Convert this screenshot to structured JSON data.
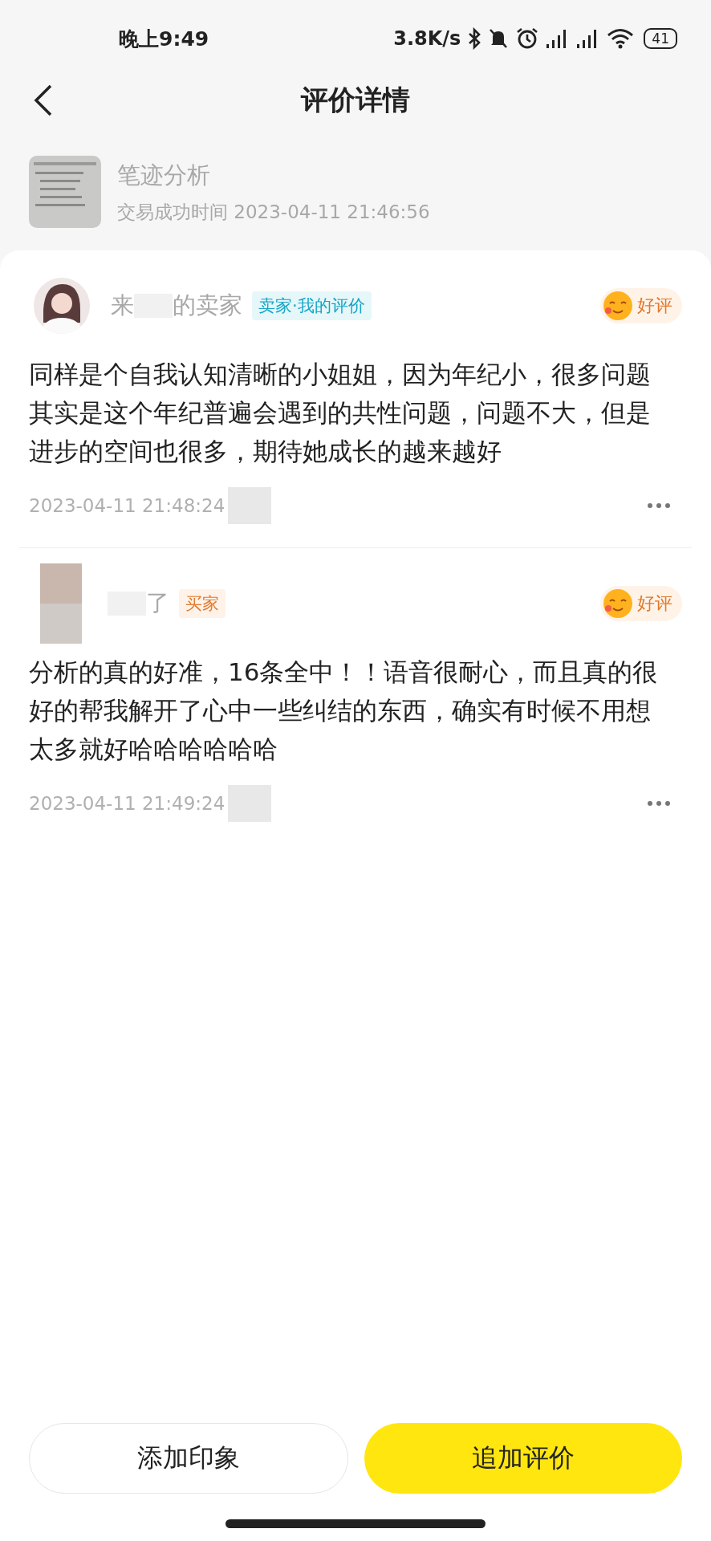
{
  "status_bar": {
    "time": "晚上9:49",
    "net_speed": "3.8K/s",
    "battery": "41"
  },
  "header": {
    "title": "评价详情"
  },
  "order": {
    "title": "笔迹分析",
    "time": "交易成功时间 2023-04-11 21:46:56"
  },
  "reviews": [
    {
      "name": {
        "before_blur": "来",
        "after_blur": "的卖家"
      },
      "tag": {
        "text": "卖家·我的评价",
        "kind": "seller"
      },
      "rating": "好评",
      "lines": [
        "同样是个自我认知清晰的小姐姐，因为年纪小，很多问题",
        "其实是这个年纪普遍会遇到的共性问题，问题不大，但是",
        "进步的空间也很多，期待她成长的越来越好"
      ],
      "date": "2023-04-11 21:48:24"
    },
    {
      "avatar": {
        "kind": "blurred"
      },
      "name": {
        "after_blur": "了"
      },
      "tag": {
        "text": "买家",
        "kind": "buyer"
      },
      "rating": "好评",
      "lines": [
        "分析的真的好准，16条全中！！语音很耐心，而且真的很",
        "好的帮我解开了心中一些纠结的东西，确实有时候不用想",
        "太多就好哈哈哈哈哈哈"
      ],
      "date": "2023-04-11 21:49:24"
    }
  ],
  "buttons": [
    {
      "label": "添加印象",
      "kind": "outline"
    },
    {
      "label": "追加评价",
      "kind": "primary"
    }
  ]
}
